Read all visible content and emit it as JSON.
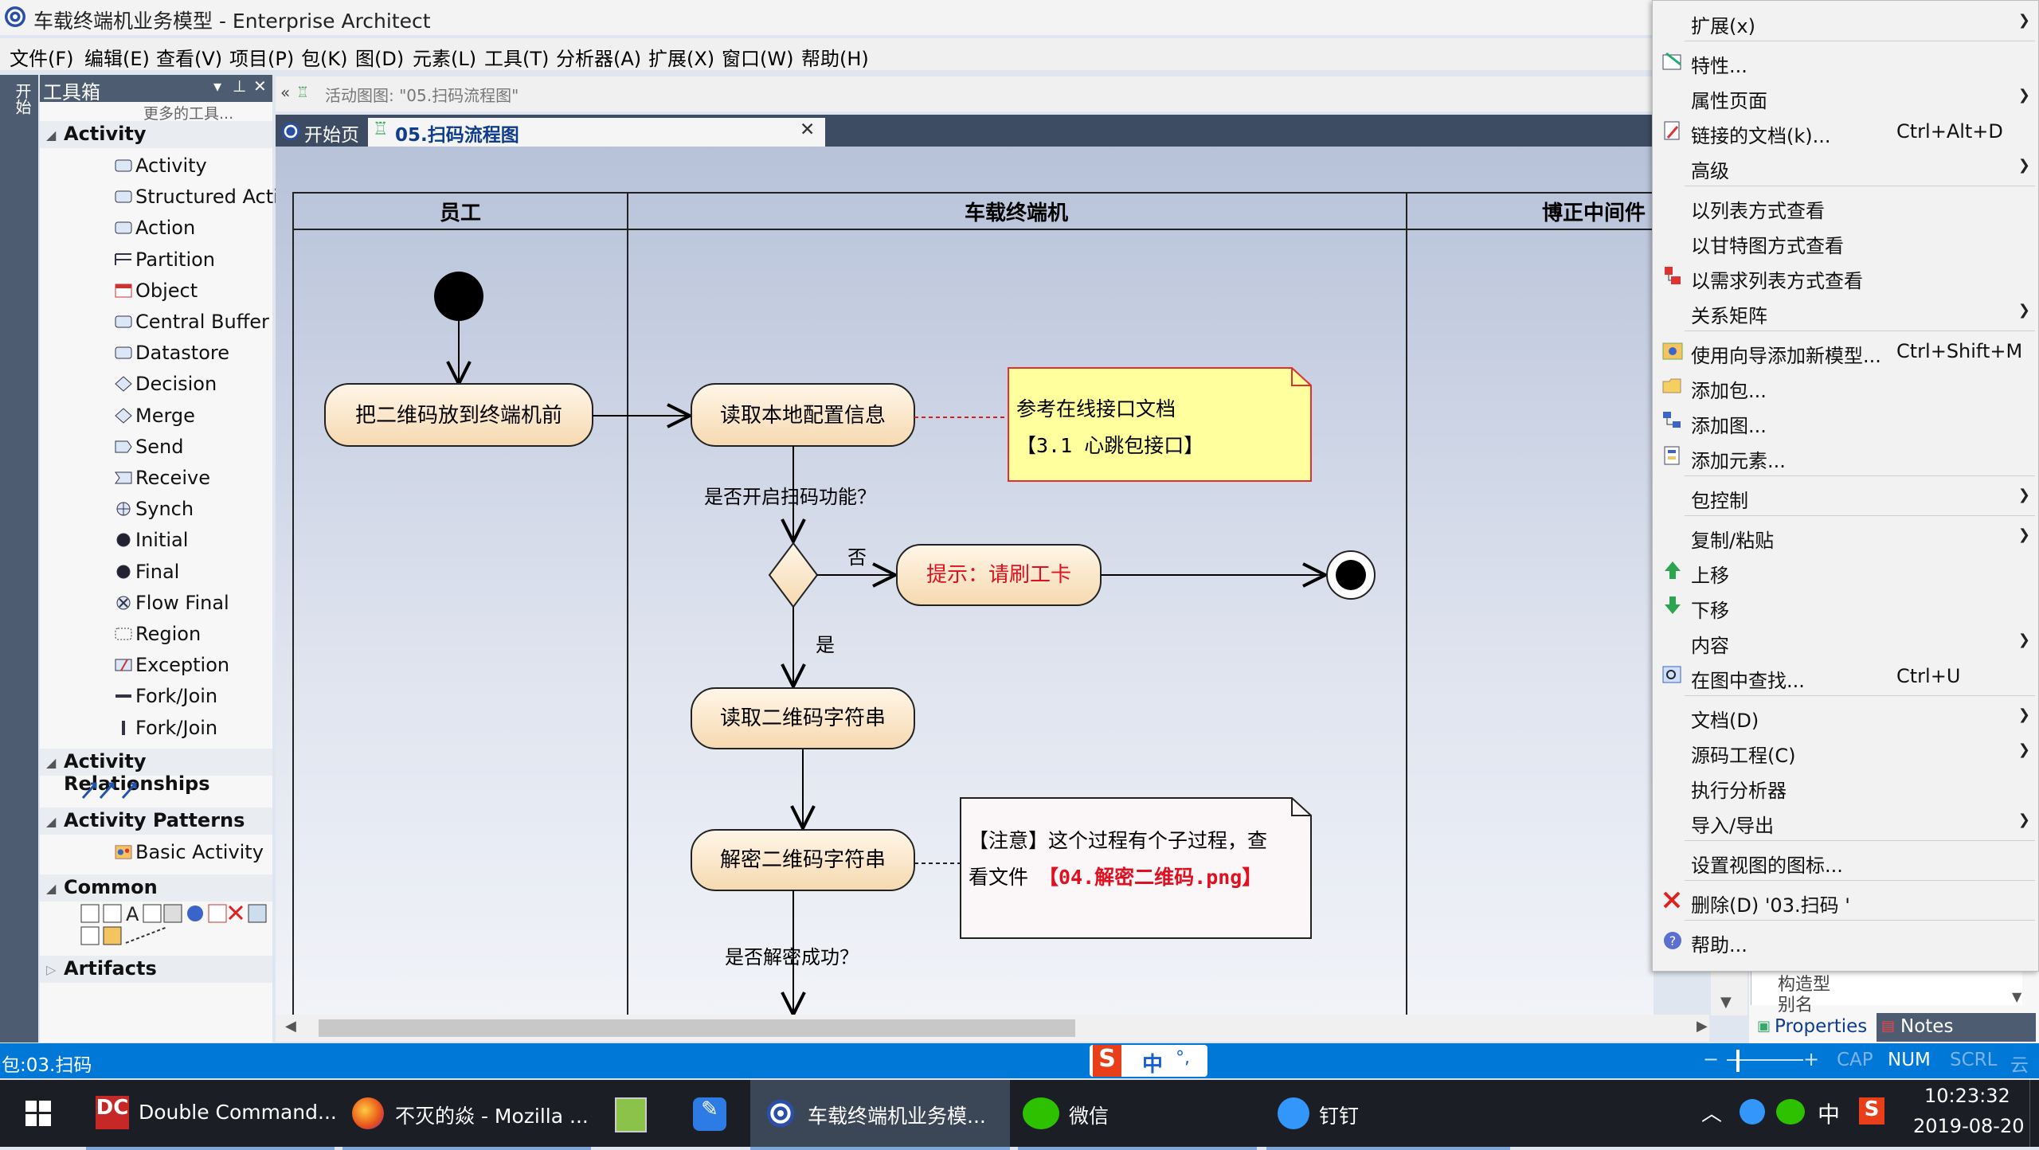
{
  "window": {
    "title": "车载终端机业务模型 - Enterprise Architect"
  },
  "menubar": [
    "文件(F)",
    "编辑(E)",
    "查看(V)",
    "项目(P)",
    "包(K)",
    "图(D)",
    "元素(L)",
    "工具(T)",
    "分析器(A)",
    "扩展(X)",
    "窗口(W)",
    "帮助(H)"
  ],
  "left_strip": {
    "label": "开始"
  },
  "toolbox": {
    "title": "工具箱",
    "more_tools": "更多的工具...",
    "groups": [
      {
        "name": "Activity",
        "items": [
          "Activity",
          "Structured Activity",
          "Action",
          "Partition",
          "Object",
          "Central Buffer Nod",
          "Datastore",
          "Decision",
          "Merge",
          "Send",
          "Receive",
          "Synch",
          "Initial",
          "Final",
          "Flow Final",
          "Region",
          "Exception",
          "Fork/Join",
          "Fork/Join"
        ]
      },
      {
        "name": "Activity Relationships",
        "items": []
      },
      {
        "name": "Activity Patterns",
        "items": [
          "Basic Activity"
        ]
      },
      {
        "name": "Common",
        "items": []
      },
      {
        "name": "Artifacts",
        "items": []
      }
    ]
  },
  "breadcrumb": {
    "back": "«",
    "path": "活动图图: \"05.扫码流程图\""
  },
  "tabs": [
    {
      "label": "开始页",
      "active": false
    },
    {
      "label": "05.扫码流程图",
      "active": true,
      "close": "✕"
    }
  ],
  "diagram": {
    "lanes": [
      "员工",
      "车载终端机",
      "博正中间件"
    ],
    "actions": {
      "put_qr": "把二维码放到终端机前",
      "read_config": "读取本地配置信息",
      "prompt": "提示：请刷工卡",
      "read_qr": "读取二维码字符串",
      "decrypt": "解密二维码字符串"
    },
    "guards": {
      "scan_enabled": "是否开启扫码功能？",
      "no": "否",
      "yes": "是",
      "decrypt_ok": "是否解密成功？"
    },
    "notes": {
      "note1_line1": "参考在线接口文档",
      "note1_line2": "【3.1 心跳包接口】",
      "note2_line1": "【注意】这个过程有个子过程，查",
      "note2_line2_prefix": "看文件",
      "note2_line2_red": "【04.解密二维码.png】"
    }
  },
  "context_menu": [
    {
      "label": "扩展(x)",
      "submenu": true,
      "icon": ""
    },
    {
      "sep": true
    },
    {
      "label": "特性...",
      "icon": "properties-icon"
    },
    {
      "label": "属性页面",
      "submenu": true,
      "icon": ""
    },
    {
      "label": "链接的文档(k)...",
      "shortcut": "Ctrl+Alt+D",
      "icon": "linked-document-icon"
    },
    {
      "label": "高级",
      "submenu": true,
      "icon": ""
    },
    {
      "sep": true
    },
    {
      "label": "以列表方式查看",
      "icon": ""
    },
    {
      "label": "以甘特图方式查看",
      "icon": ""
    },
    {
      "label": "以需求列表方式查看",
      "icon": "requirements-icon"
    },
    {
      "label": "关系矩阵",
      "submenu": true,
      "icon": ""
    },
    {
      "sep": true
    },
    {
      "label": "使用向导添加新模型...",
      "shortcut": "Ctrl+Shift+M",
      "icon": "wizard-icon"
    },
    {
      "label": "添加包...",
      "icon": "add-package-icon"
    },
    {
      "label": "添加图...",
      "icon": "add-diagram-icon"
    },
    {
      "label": "添加元素...",
      "icon": "add-element-icon"
    },
    {
      "sep": true
    },
    {
      "label": "包控制",
      "submenu": true,
      "icon": ""
    },
    {
      "sep": true
    },
    {
      "label": "复制/粘贴",
      "submenu": true,
      "icon": ""
    },
    {
      "label": "上移",
      "icon": "move-up-icon"
    },
    {
      "label": "下移",
      "icon": "move-down-icon"
    },
    {
      "label": "内容",
      "submenu": true,
      "icon": ""
    },
    {
      "label": "在图中查找...",
      "shortcut": "Ctrl+U",
      "icon": "find-in-diagram-icon"
    },
    {
      "sep": true
    },
    {
      "label": "文档(D)",
      "submenu": true,
      "icon": ""
    },
    {
      "label": "源码工程(C)",
      "submenu": true,
      "icon": ""
    },
    {
      "label": "执行分析器",
      "icon": ""
    },
    {
      "label": "导入/导出",
      "submenu": true,
      "icon": ""
    },
    {
      "sep": true
    },
    {
      "label": "设置视图的图标...",
      "icon": ""
    },
    {
      "sep": true
    },
    {
      "label": "删除(D) '03.扫码 '",
      "icon": "delete-icon"
    },
    {
      "sep": true
    },
    {
      "label": "帮助...",
      "icon": "help-icon"
    }
  ],
  "properties_panel": {
    "row1": "构造型",
    "row2": "别名",
    "tab_properties": "Properties",
    "tab_notes": "Notes"
  },
  "statusbar": {
    "left": "包:03.扫码",
    "ime_lang": "中",
    "ime_punct": "°,",
    "zoom_minus": "−",
    "zoom_plus": "+",
    "cap": "CAP",
    "num": "NUM",
    "scrl": "SCRL",
    "cloud": "云"
  },
  "taskbar": {
    "items": [
      "Double Command...",
      "不灭的焱 - Mozilla ...",
      "车载终端机业务模...",
      "微信",
      "钉钉"
    ],
    "tray_lang": "中",
    "time": "10:23:32",
    "date": "2019-08-20"
  },
  "colors": {
    "accent": "#0078d7",
    "action_fill": "#fbe4c4",
    "note_yellow": "#ffff9e",
    "note_border": "#e03030",
    "red_text": "#e01020"
  }
}
